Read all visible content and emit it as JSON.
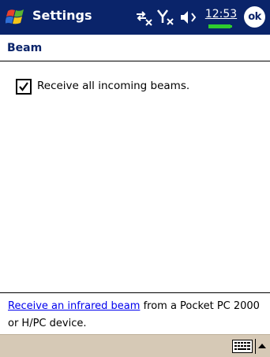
{
  "titlebar": {
    "app_title": "Settings",
    "clock": "12:53",
    "ok_label": "ok",
    "icons": [
      "start-flag-icon",
      "sync-disconnected-icon",
      "signal-off-icon",
      "volume-icon",
      "battery-icon"
    ],
    "background": "#0a246a"
  },
  "page": {
    "heading": "Beam",
    "checkbox": {
      "label": "Receive all incoming beams.",
      "checked": true
    }
  },
  "info": {
    "link_text": "Receive an infrared beam",
    "rest_text": " from a Pocket PC 2000 or H/PC device."
  },
  "command_bar": {
    "icons": [
      "keyboard-icon",
      "sip-arrow-up-icon"
    ],
    "background": "#d6c9b6"
  }
}
